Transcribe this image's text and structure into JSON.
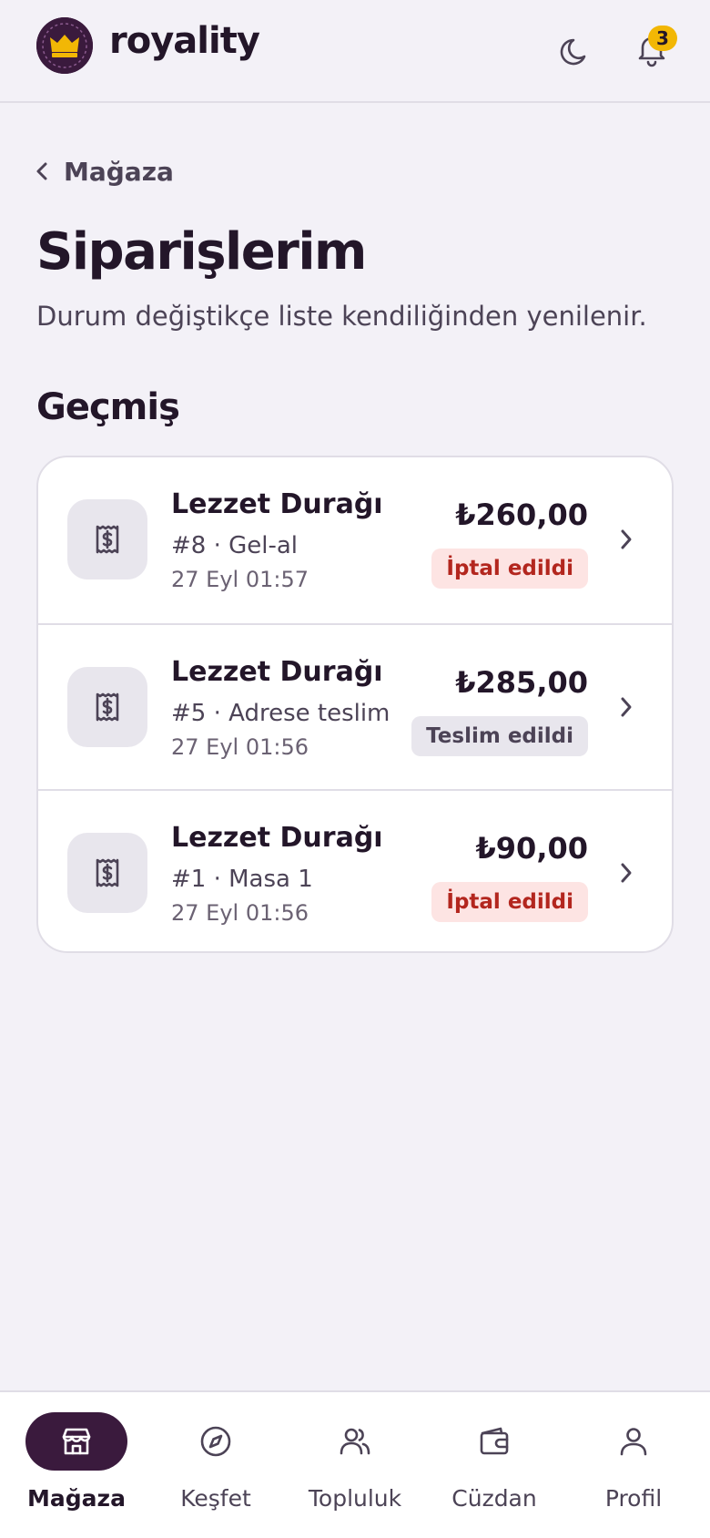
{
  "header": {
    "brand": "royality",
    "notification_count": "3"
  },
  "nav": {
    "back_label": "Mağaza"
  },
  "page": {
    "title": "Siparişlerim",
    "subtitle": "Durum değiştikçe liste kendiliğinden yenilenir.",
    "section": "Geçmiş"
  },
  "orders": [
    {
      "store": "Lezzet Durağı",
      "meta": "#8 · Gel-al",
      "date": "27 Eyl 01:57",
      "amount": "₺260,00",
      "status": "İptal edildi",
      "status_kind": "cancelled"
    },
    {
      "store": "Lezzet Durağı",
      "meta": "#5 · Adrese teslim",
      "date": "27 Eyl 01:56",
      "amount": "₺285,00",
      "status": "Teslim edildi",
      "status_kind": "delivered"
    },
    {
      "store": "Lezzet Durağı",
      "meta": "#1 · Masa 1",
      "date": "27 Eyl 01:56",
      "amount": "₺90,00",
      "status": "İptal edildi",
      "status_kind": "cancelled"
    }
  ],
  "bottom_nav": {
    "items": [
      {
        "label": "Mağaza",
        "icon": "store-icon",
        "active": true
      },
      {
        "label": "Keşfet",
        "icon": "compass-icon",
        "active": false
      },
      {
        "label": "Topluluk",
        "icon": "users-icon",
        "active": false
      },
      {
        "label": "Cüzdan",
        "icon": "wallet-icon",
        "active": false
      },
      {
        "label": "Profil",
        "icon": "user-icon",
        "active": false
      }
    ]
  },
  "colors": {
    "background": "#f3f1f7",
    "brand_dark": "#3a1a3d",
    "accent_yellow": "#f2b705",
    "cancelled_bg": "#fde4e3",
    "cancelled_text": "#b3261e",
    "delivered_bg": "#e8e6ed",
    "delivered_text": "#4c4356"
  }
}
